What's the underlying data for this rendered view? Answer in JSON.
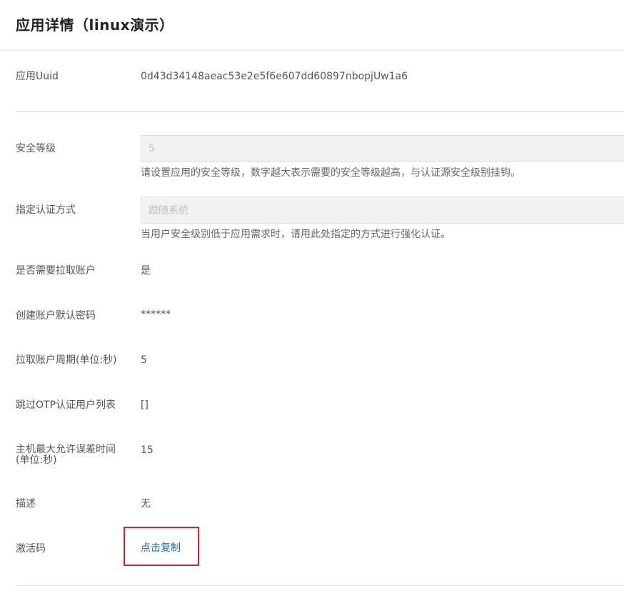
{
  "header": {
    "title": "应用详情（linux演示）"
  },
  "fields": {
    "uuid": {
      "label": "应用Uuid",
      "value": "0d43d34148aeac53e2e5f6e607dd60897nbopjUw1a6"
    },
    "security_level": {
      "label": "安全等级",
      "value": "5",
      "hint": "请设置应用的安全等级，数字越大表示需要的安全等级越高，与认证源安全级别挂钩。"
    },
    "auth_method": {
      "label": "指定认证方式",
      "value": "跟随系统",
      "hint": "当用户安全级别低于应用需求时，请用此处指定的方式进行强化认证。"
    },
    "pull_account": {
      "label": "是否需要拉取账户",
      "value": "是"
    },
    "default_password": {
      "label": "创建账户默认密码",
      "value": "******"
    },
    "pull_period": {
      "label": "拉取账户周期(单位:秒)",
      "value": "5"
    },
    "skip_otp": {
      "label": "跳过OTP认证用户列表",
      "value": "[]"
    },
    "max_time_error": {
      "label_line1": "主机最大允许误差时间",
      "label_line2": "(单位:秒)",
      "value": "15"
    },
    "description": {
      "label": "描述",
      "value": "无"
    },
    "activation_code": {
      "label": "激活码",
      "link": "点击复制"
    }
  },
  "colors": {
    "link": "#1a6fc2",
    "highlight_border": "#e02020"
  }
}
